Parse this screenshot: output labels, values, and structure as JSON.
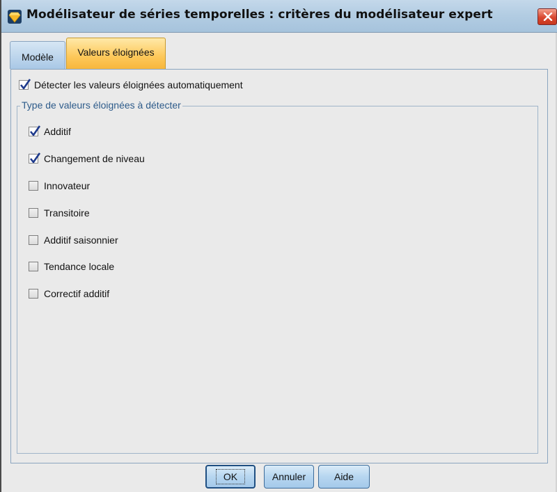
{
  "window": {
    "title": "Modélisateur de séries temporelles : critères du modélisateur expert"
  },
  "tabs": [
    {
      "label": "Modèle",
      "active": false
    },
    {
      "label": "Valeurs éloignées",
      "active": true
    }
  ],
  "auto_detect": {
    "label": "Détecter les valeurs éloignées automatiquement",
    "checked": true
  },
  "outlier_group": {
    "legend": "Type de valeurs éloignées à détecter",
    "items": [
      {
        "label": "Additif",
        "checked": true
      },
      {
        "label": "Changement de niveau",
        "checked": true
      },
      {
        "label": "Innovateur",
        "checked": false
      },
      {
        "label": "Transitoire",
        "checked": false
      },
      {
        "label": "Additif saisonnier",
        "checked": false
      },
      {
        "label": "Tendance locale",
        "checked": false
      },
      {
        "label": "Correctif additif",
        "checked": false
      }
    ]
  },
  "buttons": {
    "ok": "OK",
    "cancel": "Annuler",
    "help": "Aide"
  },
  "icons": {
    "app": "diamond-model-icon",
    "close": "close-icon",
    "check": "checkmark-icon"
  },
  "colors": {
    "active_tab": "#fdc85a",
    "inactive_tab": "#a9c8e6",
    "legend_text": "#2d5b8a",
    "close_button": "#d9472f"
  }
}
